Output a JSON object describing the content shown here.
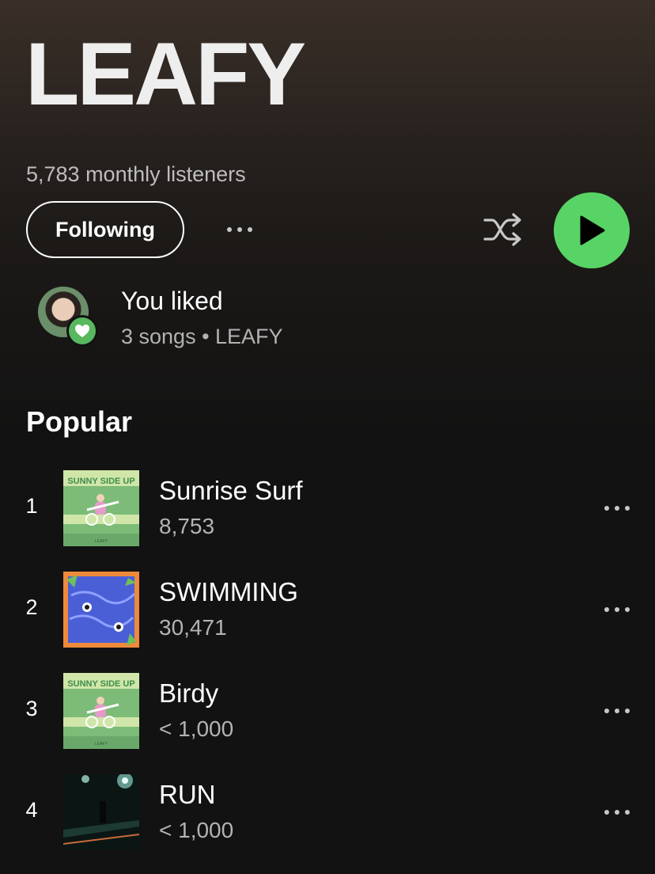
{
  "artist": {
    "name": "LEAFY",
    "monthly_listeners": "5,783 monthly listeners",
    "follow_label": "Following"
  },
  "liked": {
    "title": "You liked",
    "subtitle": "3 songs • LEAFY"
  },
  "popular": {
    "heading": "Popular",
    "tracks": [
      {
        "rank": "1",
        "title": "Sunrise Surf",
        "plays": "8,753",
        "art": "sunny-side-up-cover"
      },
      {
        "rank": "2",
        "title": "SWIMMING",
        "plays": "30,471",
        "art": "swimming-cover"
      },
      {
        "rank": "3",
        "title": "Birdy",
        "plays": "< 1,000",
        "art": "sunny-side-up-cover"
      },
      {
        "rank": "4",
        "title": "RUN",
        "plays": "< 1,000",
        "art": "run-cover"
      }
    ]
  },
  "icons": [
    "more-icon",
    "shuffle-icon",
    "play-icon",
    "heart-icon"
  ],
  "colors": {
    "accent_green": "#57d465",
    "background": "#121212",
    "secondary_text": "#b3b3b3"
  },
  "album_art_text": {
    "sunny_side_up_title": "SUNNY SIDE UP",
    "sunny_side_up_artist": "LEAFY"
  }
}
